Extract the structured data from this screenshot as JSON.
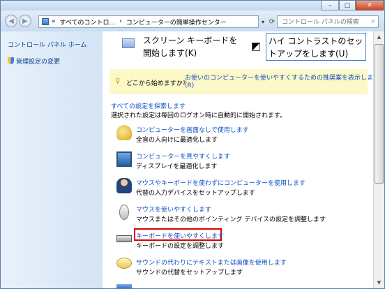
{
  "window": {
    "title_buttons": [
      "–",
      "□",
      "✕"
    ]
  },
  "nav": {
    "address_parts": [
      "«",
      "すべてのコントロ...",
      "›",
      "コンピューターの簡単操作センター"
    ],
    "search_placeholder": "コントロール パネルの検索"
  },
  "sidebar": {
    "home": "コントロール パネル ホーム",
    "admin": "管理設定の変更"
  },
  "quick": {
    "osk_line1": "スクリーン キーボードを",
    "osk_line2": "開始します(K)",
    "hc_line1": "ハイ コントラストのセッ",
    "hc_line2": "トアップをします(U)"
  },
  "tip": {
    "label": "どこから始めますか?",
    "link1": "お使いのコンピューターを使いやすくするための推奨案を表示します",
    "link2": "(R)"
  },
  "settings": {
    "explore": "すべての設定を探索します",
    "note": "選択された設定は毎回のログオン時に自動的に開始されます。",
    "items": [
      {
        "title": "コンピューターを画面なしで使用します",
        "desc": "全盲の人向けに最適化します"
      },
      {
        "title": "コンピューターを見やすくします",
        "desc": "ディスプレイを最適化します"
      },
      {
        "title": "マウスやキーボードを使わずにコンピューターを使用します",
        "desc": "代替の入力デバイスをセットアップします"
      },
      {
        "title": "マウスを使いやすくします",
        "desc": "マウスまたはその他のポインティング デバイスの設定を調整します"
      },
      {
        "title": "キーボードを使いやすくします",
        "desc": "キーボードの設定を調整します"
      },
      {
        "title": "サウンドの代わりにテキストまたは画像を使用します",
        "desc": "サウンドの代替をセットアップします"
      }
    ]
  },
  "colors": {
    "link": "#0a4ec4",
    "highlight_box": "#e00000",
    "tip_bg": "#fdf8c8"
  }
}
